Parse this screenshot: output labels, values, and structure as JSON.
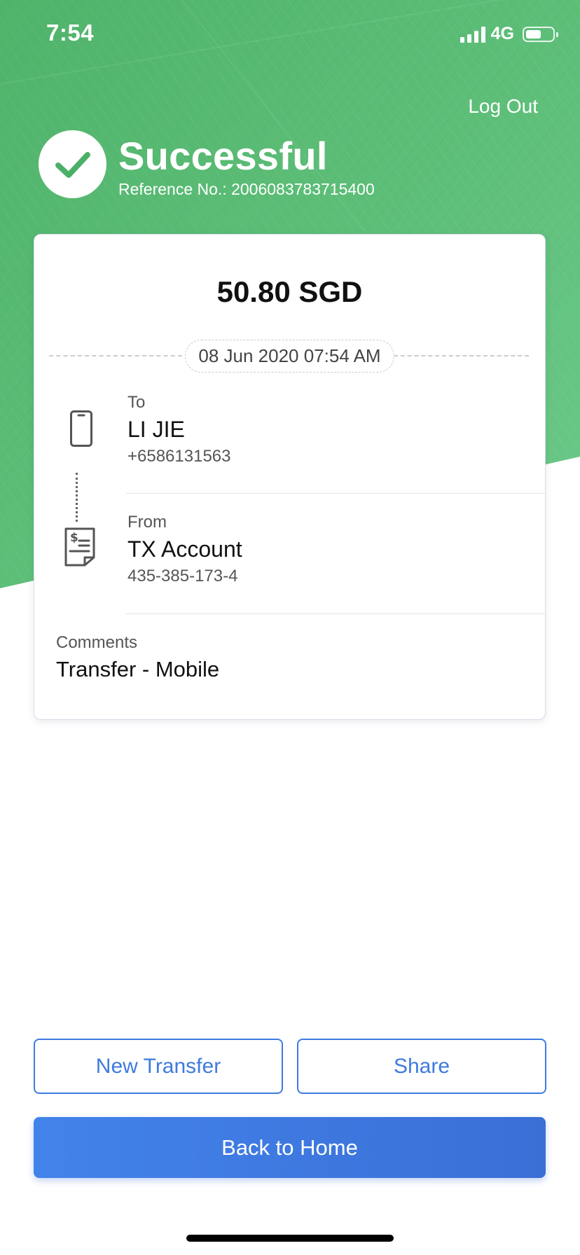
{
  "status_bar": {
    "time": "7:54",
    "network": "4G",
    "battery_level": 0.56
  },
  "header": {
    "logout_label": "Log Out",
    "status_title": "Successful",
    "reference": "Reference No.: 2006083783715400"
  },
  "transaction": {
    "amount": "50.80 SGD",
    "datetime": "08 Jun 2020 07:54 AM",
    "to": {
      "label": "To",
      "name": "LI JIE",
      "phone": "+6586131563"
    },
    "from": {
      "label": "From",
      "name": "TX Account",
      "account": "435-385-173-4"
    },
    "comments": {
      "label": "Comments",
      "value": "Transfer - Mobile"
    }
  },
  "actions": {
    "new_transfer": "New Transfer",
    "share": "Share",
    "back_home": "Back to Home"
  },
  "colors": {
    "hero_green": "#5bbd77",
    "accent_blue": "#3e7be0",
    "white": "#ffffff"
  },
  "icons": {
    "success": "checkmark-icon",
    "to": "mobile-phone-icon",
    "from": "bill-dollar-icon"
  }
}
